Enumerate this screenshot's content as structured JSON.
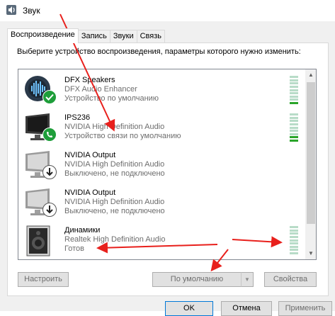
{
  "window": {
    "title": "Звук"
  },
  "tabs": [
    {
      "label": "Воспроизведение",
      "active": true
    },
    {
      "label": "Запись",
      "active": false
    },
    {
      "label": "Звуки",
      "active": false
    },
    {
      "label": "Связь",
      "active": false
    }
  ],
  "instruction": "Выберите устройство воспроизведения, параметры которого нужно изменить:",
  "devices": [
    {
      "name": "DFX Speakers",
      "description": "DFX Audio Enhancer",
      "status": "Устройство по умолчанию",
      "icon": "dfx-speaker-icon",
      "badge": "check-badge-icon",
      "meter": "active"
    },
    {
      "name": "IPS236",
      "description": "NVIDIA High Definition Audio",
      "status": "Устройство связи по умолчанию",
      "icon": "monitor-icon",
      "badge": "phone-badge-icon",
      "meter": "active"
    },
    {
      "name": "NVIDIA Output",
      "description": "NVIDIA High Definition Audio",
      "status": "Выключено, не подключено",
      "icon": "monitor-disabled-icon",
      "badge": "down-arrow-badge-icon",
      "meter": "none"
    },
    {
      "name": "NVIDIA Output",
      "description": "NVIDIA High Definition Audio",
      "status": "Выключено, не подключено",
      "icon": "monitor-disabled-icon",
      "badge": "down-arrow-badge-icon",
      "meter": "none"
    },
    {
      "name": "Динамики",
      "description": "Realtek High Definition Audio",
      "status": "Готов",
      "icon": "speaker-icon",
      "badge": "",
      "meter": "idle"
    }
  ],
  "buttons": {
    "configure": "Настроить",
    "set_default": "По умолчанию",
    "properties": "Свойства",
    "ok": "OK",
    "cancel": "Отмена",
    "apply": "Применить"
  },
  "colors": {
    "annotation_arrow": "#e8201c",
    "meter_green": "#2aa52a",
    "badge_green": "#1e9e3a"
  }
}
